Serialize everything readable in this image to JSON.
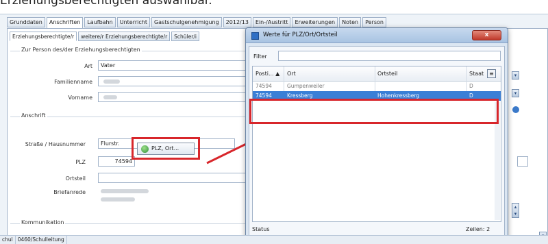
{
  "caption": "Erziehungsberechtigten auswählbar.",
  "main_tabs": [
    "Grunddaten",
    "Anschriften",
    "Laufbahn",
    "Unterricht",
    "Gastschulgenehmigung",
    "2012/13",
    "Ein-/Austritt",
    "Erweiterungen",
    "Noten",
    "Person"
  ],
  "sub_tabs": [
    "Erziehungsberechtigte/r",
    "weitere/r Erziehungsberechtigte/r",
    "Schüler/i"
  ],
  "section_person": "Zur Person des/der Erziehungsberechtigten",
  "section_address": "Anschrift",
  "section_comm": "Kommunikation",
  "labels": {
    "art": "Art",
    "familienname": "Familienname",
    "vorname": "Vorname",
    "strasse": "Straße / Hausnummer",
    "plz": "PLZ",
    "ortsteil": "Ortsteil",
    "briefanrede": "Briefanrede"
  },
  "values": {
    "art": "Vater",
    "strasse": "Flurstr.",
    "plz": "74594"
  },
  "plz_button": "PLZ, Ort...",
  "status_items": [
    "chul",
    "0460/Schulleitung"
  ],
  "dialog": {
    "title": "Werte für PLZ/Ort/Ortsteil",
    "close": "x",
    "filter_label": "Filter",
    "columns": [
      "Posti... ▲",
      "Ort",
      "Ortsteil",
      "Staat"
    ],
    "rows": [
      {
        "plz": "74594",
        "ort": "Gumpenweiler",
        "ortsteil": "",
        "staat": "D"
      },
      {
        "plz": "74594",
        "ort": "Kressberg",
        "ortsteil": "Hohenkressberg",
        "staat": "D"
      }
    ],
    "status": "Status",
    "count": "Zeilen: 2"
  }
}
